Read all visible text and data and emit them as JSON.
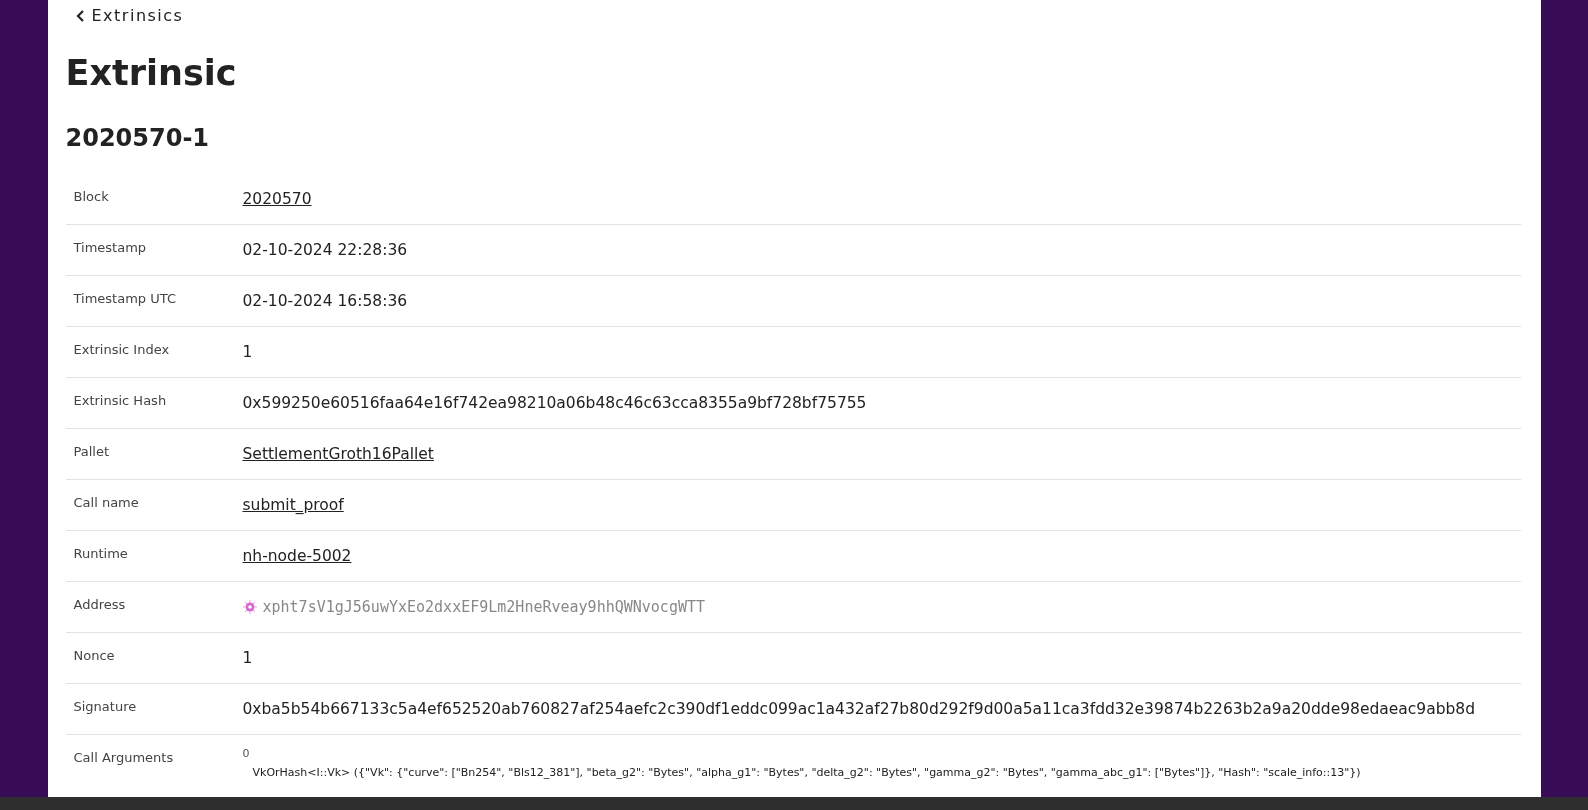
{
  "back_link": {
    "label": "Extrinsics"
  },
  "title": "Extrinsic",
  "subtitle": "2020570-1",
  "rows": [
    {
      "label": "Block",
      "kind": "link",
      "value": "2020570"
    },
    {
      "label": "Timestamp",
      "kind": "text",
      "value": "02-10-2024 22:28:36"
    },
    {
      "label": "Timestamp UTC",
      "kind": "text",
      "value": "02-10-2024 16:58:36"
    },
    {
      "label": "Extrinsic Index",
      "kind": "text",
      "value": "1"
    },
    {
      "label": "Extrinsic Hash",
      "kind": "text",
      "value": "0x599250e60516faa64e16f742ea98210a06b48c46c63cca8355a9bf728bf75755"
    },
    {
      "label": "Pallet",
      "kind": "link",
      "value": "SettlementGroth16Pallet"
    },
    {
      "label": "Call name",
      "kind": "link",
      "value": "submit_proof"
    },
    {
      "label": "Runtime",
      "kind": "link",
      "value": "nh-node-5002"
    },
    {
      "label": "Address",
      "kind": "address",
      "value": "xpht7sV1gJ56uwYxEo2dxxEF9Lm2HneRveay9hhQWNvocgWTT"
    },
    {
      "label": "Nonce",
      "kind": "text",
      "value": "1"
    },
    {
      "label": "Signature",
      "kind": "text",
      "value": "0xba5b54b667133c5a4ef652520ab760827af254aefc2c390df1eddc099ac1a432af27b80d292f9d00a5a11ca3fdd32e39874b2263b2a9a20dde98edaeac9abb8d"
    },
    {
      "label": "Call Arguments",
      "kind": "args",
      "index": "0",
      "value": "VkOrHash<I::Vk> ({\"Vk\": {\"curve\": [\"Bn254\", \"Bls12_381\"], \"beta_g2\": \"Bytes\", \"alpha_g1\": \"Bytes\", \"delta_g2\": \"Bytes\", \"gamma_g2\": \"Bytes\", \"gamma_abc_g1\": [\"Bytes\"]}, \"Hash\": \"scale_info::13\"})"
    }
  ]
}
